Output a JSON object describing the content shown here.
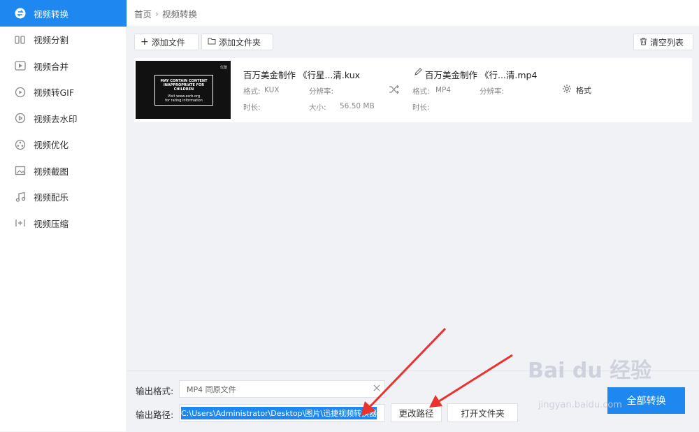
{
  "sidebar": {
    "items": [
      {
        "label": "视频转换",
        "icon": "convert-icon"
      },
      {
        "label": "视频分割",
        "icon": "split-icon"
      },
      {
        "label": "视频合并",
        "icon": "merge-icon"
      },
      {
        "label": "视频转GIF",
        "icon": "gif-icon"
      },
      {
        "label": "视频去水印",
        "icon": "watermark-remove-icon"
      },
      {
        "label": "视频优化",
        "icon": "optimize-icon"
      },
      {
        "label": "视频截图",
        "icon": "screenshot-icon"
      },
      {
        "label": "视频配乐",
        "icon": "music-icon"
      },
      {
        "label": "视频压缩",
        "icon": "compress-icon"
      }
    ]
  },
  "breadcrumb": {
    "home": "首页",
    "sep": "›",
    "current": "视频转换"
  },
  "toolbar": {
    "add_file": "添加文件",
    "add_folder": "添加文件夹",
    "clear_list": "清空列表"
  },
  "file": {
    "thumb_line1": "MAY CONTAIN CONTENT",
    "thumb_line2": "INAPPROPRIATE FOR CHILDREN",
    "thumb_line3": "Visit www.esrb.org",
    "thumb_line4": "for rating information",
    "thumb_corner": "优酷",
    "source_name": "百万美金制作 《行星...清.kux",
    "source_format_label": "格式:",
    "source_format": "KUX",
    "source_res_label": "分辨率:",
    "source_duration_label": "时长:",
    "source_size_label": "大小:",
    "source_size": "56.50 MB",
    "target_name": "百万美金制作 《行...清.mp4",
    "target_format_label": "格式:",
    "target_format": "MP4",
    "target_res_label": "分辨率:",
    "target_duration_label": "时长:",
    "format_button": "格式"
  },
  "bottom": {
    "output_format_label": "输出格式:",
    "output_format_value": "MP4  同原文件",
    "output_path_label": "输出路径:",
    "output_path_value": "C:\\Users\\Administrator\\Desktop\\图片\\迅捷视频转换器",
    "change_path": "更改路径",
    "open_folder": "打开文件夹",
    "convert_all": "全部转换"
  },
  "watermark": {
    "main": "Bai du 经验",
    "sub": "jingyan.baidu.com"
  },
  "colors": {
    "accent": "#1e88f0",
    "arrow": "#e8332f"
  }
}
